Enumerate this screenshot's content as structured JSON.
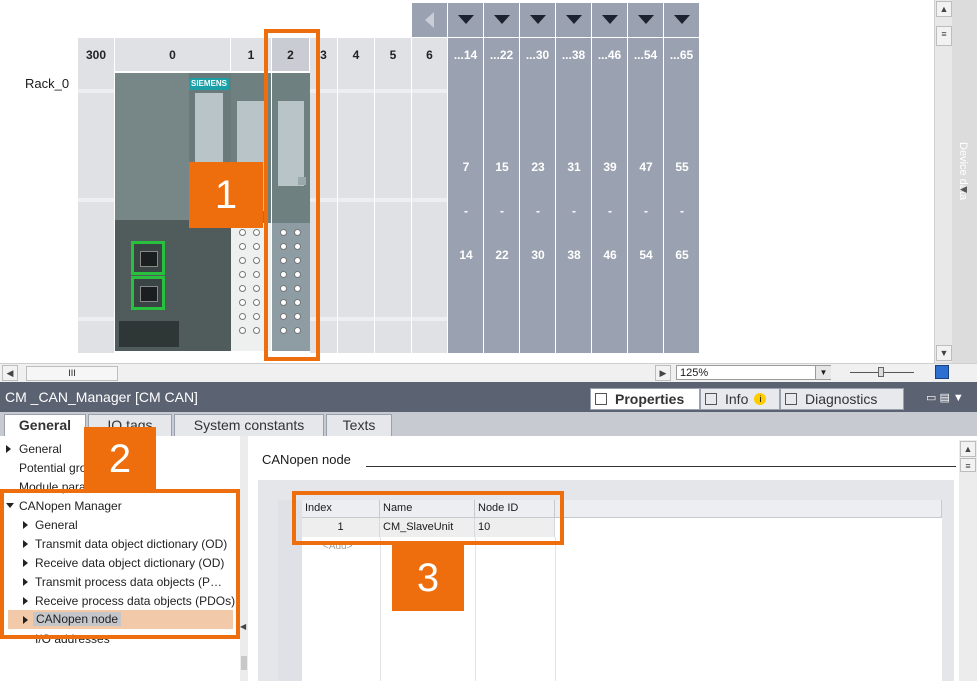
{
  "device_view": {
    "rack_label": "Rack_0",
    "slots": [
      "300",
      "0",
      "1",
      "2",
      "3",
      "4",
      "5",
      "6",
      "...14",
      "...22",
      "...30",
      "...38",
      "...46",
      "...54",
      "...65"
    ],
    "range_start": [
      "7",
      "15",
      "23",
      "31",
      "39",
      "47",
      "55"
    ],
    "range_sep": "-",
    "range_end": [
      "14",
      "22",
      "30",
      "38",
      "46",
      "54",
      "65"
    ],
    "brand": "SIEMENS",
    "zoom": "125%",
    "scroll_thumb": "III",
    "side_tab": "Device data"
  },
  "callouts": {
    "c1": "1",
    "c2": "2",
    "c3": "3"
  },
  "inspector": {
    "title": "CM _CAN_Manager [CM CAN]",
    "panel_tabs": {
      "properties": "Properties",
      "info": "Info",
      "diagnostics": "Diagnostics"
    },
    "tabs": [
      "General",
      "IO tags",
      "System constants",
      "Texts"
    ],
    "nav": {
      "general": "General",
      "potential": "Potential group",
      "module_params": "Module parameters",
      "canopen_manager": "CANopen Manager",
      "sub_general": "General",
      "tx_od": "Transmit data object dictionary (OD)",
      "rx_od": "Receive data object dictionary (OD)",
      "tx_pdo": "Transmit process data objects (P…",
      "rx_pdo": "Receive process data objects (PDOs)",
      "canopen_node": "CANopen node",
      "io_addresses": "I/O addresses"
    },
    "section_title": "CANopen node",
    "grid": {
      "headers": [
        "Index",
        "Name",
        "Node ID"
      ],
      "row": [
        "1",
        "CM_SlaveUnit",
        "10"
      ],
      "add_label": "<Add>"
    }
  },
  "colors": {
    "accent": "#ee6d0c",
    "slot_grey": "#9aa1b0",
    "title_bar": "#5b6272"
  }
}
